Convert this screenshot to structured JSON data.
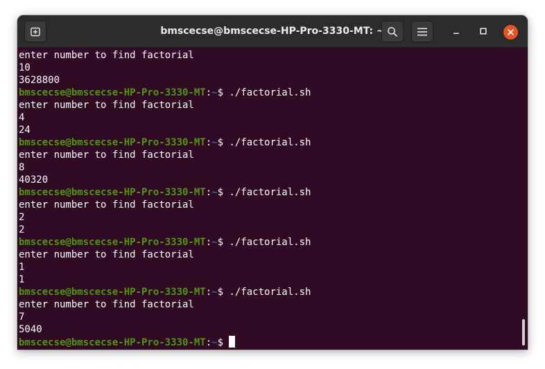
{
  "window": {
    "title": "bmscecse@bmscecse-HP-Pro-3330-MT: ~"
  },
  "toolbar": {
    "new_tab_icon": "new-tab-icon",
    "search_icon": "search-icon",
    "menu_icon": "hamburger-menu-icon",
    "minimize_icon": "minimize-icon",
    "maximize_icon": "maximize-icon",
    "close_icon": "close-icon"
  },
  "colors": {
    "terminal_bg": "#300a24",
    "prompt_user": "#4e9a06",
    "prompt_path": "#3465a4",
    "close_button": "#e95420",
    "titlebar_bg": "#2c2c2c"
  },
  "prompt": {
    "user_host": "bmscecse@bmscecse-HP-Pro-3330-MT",
    "colon": ":",
    "path": "~",
    "dollar": "$ "
  },
  "terminal_lines": [
    {
      "kind": "out",
      "text": "enter number to find factorial"
    },
    {
      "kind": "out",
      "text": "10"
    },
    {
      "kind": "out",
      "text": "3628800"
    },
    {
      "kind": "prompt",
      "command": "./factorial.sh"
    },
    {
      "kind": "out",
      "text": "enter number to find factorial"
    },
    {
      "kind": "out",
      "text": "4"
    },
    {
      "kind": "out",
      "text": "24"
    },
    {
      "kind": "prompt",
      "command": "./factorial.sh"
    },
    {
      "kind": "out",
      "text": "enter number to find factorial"
    },
    {
      "kind": "out",
      "text": "8"
    },
    {
      "kind": "out",
      "text": "40320"
    },
    {
      "kind": "prompt",
      "command": "./factorial.sh"
    },
    {
      "kind": "out",
      "text": "enter number to find factorial"
    },
    {
      "kind": "out",
      "text": "2"
    },
    {
      "kind": "out",
      "text": "2"
    },
    {
      "kind": "prompt",
      "command": "./factorial.sh"
    },
    {
      "kind": "out",
      "text": "enter number to find factorial"
    },
    {
      "kind": "out",
      "text": "1"
    },
    {
      "kind": "out",
      "text": "1"
    },
    {
      "kind": "prompt",
      "command": "./factorial.sh"
    },
    {
      "kind": "out",
      "text": "enter number to find factorial"
    },
    {
      "kind": "out",
      "text": "7"
    },
    {
      "kind": "out",
      "text": "5040"
    },
    {
      "kind": "prompt",
      "command": "",
      "cursor": true
    }
  ]
}
